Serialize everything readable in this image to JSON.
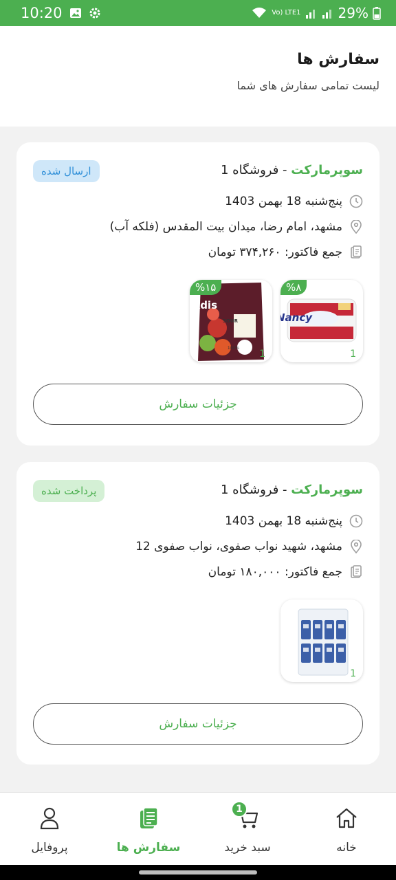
{
  "status_bar": {
    "time": "10:20",
    "network": "Vo) LTE1",
    "battery": "29%"
  },
  "header": {
    "title": "سفارش ها",
    "subtitle": "لیست تمامی سفارش های شما"
  },
  "orders": [
    {
      "store_brand": "سوپرمارکت",
      "store_name": " - فروشگاه 1",
      "status": "ارسال شده",
      "date": "پنج‌شنبه 18 بهمن 1403",
      "address": "مشهد، امام رضا، میدان بیت المقدس (فلکه آب)",
      "total": "جمع فاکتور: ۳۷۴,۲۶۰ تومان",
      "products": [
        {
          "name": "Nancy",
          "discount": "%۸",
          "qty": "1"
        },
        {
          "name": "Takdis",
          "discount": "%۱۵",
          "qty": "1"
        }
      ],
      "details_label": "جزئیات سفارش"
    },
    {
      "store_brand": "سوپرمارکت",
      "store_name": " - فروشگاه 1",
      "status": "پرداخت شده",
      "date": "پنج‌شنبه 18 بهمن 1403",
      "address": "مشهد، شهید نواب صفوی، نواب صفوی 12",
      "total": "جمع فاکتور: ۱۸۰,۰۰۰ تومان",
      "products": [
        {
          "name": "tissue-pack",
          "qty": "1"
        }
      ],
      "details_label": "جزئیات سفارش"
    }
  ],
  "bottom_nav": {
    "home": "خانه",
    "cart": "سبد خرید",
    "cart_count": "1",
    "orders": "سفارش ها",
    "profile": "پروفایل"
  },
  "colors": {
    "accent": "#4caf50",
    "sent_badge": "#2f8fd8",
    "paid_badge": "#4caf50"
  }
}
